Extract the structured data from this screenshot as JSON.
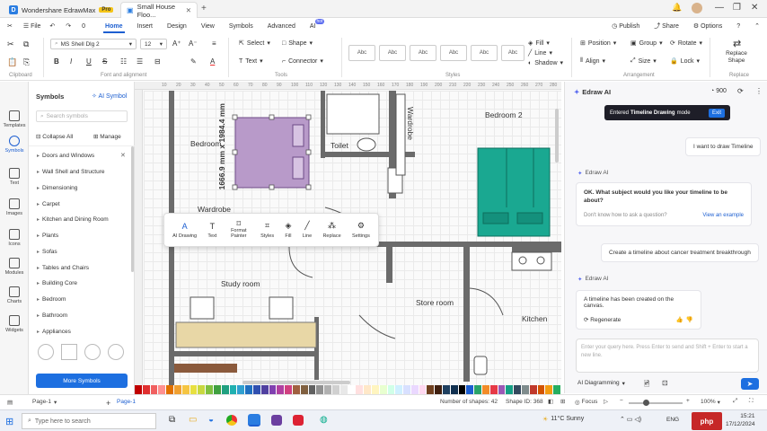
{
  "titlebar": {
    "app_name": "Wondershare EdrawMax",
    "pro": "Pro",
    "doc_tab": "Small House Floo...",
    "new_tab": "+"
  },
  "menubar": {
    "file": "File",
    "undo": "↶",
    "redo": "↷",
    "items": [
      "Home",
      "Insert",
      "Design",
      "View",
      "Symbols",
      "Advanced",
      "AI"
    ],
    "ai_badge": "hot",
    "publish": "Publish",
    "share": "Share",
    "options": "Options",
    "zero": "0"
  },
  "ribbon": {
    "font_name": "MS Shell Dlg 2",
    "font_size": "12",
    "select": "Select",
    "shape": "Shape",
    "text": "Text",
    "connector": "Connector",
    "style_swatches": [
      "Abc",
      "Abc",
      "Abc",
      "Abc",
      "Abc",
      "Abc",
      "Abc"
    ],
    "fill": "Fill",
    "line": "Line",
    "shadow": "Shadow",
    "position": "Position",
    "group": "Group",
    "rotate": "Rotate",
    "align": "Align",
    "size": "Size",
    "lock": "Lock",
    "replace_shape": "Replace Shape",
    "groups": {
      "clipboard": "Clipboard",
      "font": "Font and alignment",
      "tools": "Tools",
      "styles": "Styles",
      "arrangement": "Arrangement",
      "replace": "Replace"
    }
  },
  "rail": [
    "Templates",
    "Symbols",
    "Text",
    "Images",
    "Icons",
    "Modules",
    "Charts",
    "Widgets"
  ],
  "symbols_panel": {
    "title": "Symbols",
    "ai_symbol": "AI Symbol",
    "search_placeholder": "Search symbols",
    "collapse_all": "Collapse All",
    "manage": "Manage",
    "libraries": [
      "Doors and Windows",
      "Wall Shell and Structure",
      "Dimensioning",
      "Carpet",
      "Kitchen and Dining Room",
      "Plants",
      "Sofas",
      "Tables and Chairs",
      "Building Core",
      "Bedroom",
      "Bathroom",
      "Appliances"
    ],
    "more_symbols": "More Symbols"
  },
  "canvas": {
    "rooms": {
      "bedroom_left": "Bedroom",
      "bedroom2": "Bedroom 2",
      "toilet": "Toilet",
      "wardrobe_right": "Wardrobe",
      "wardrobe_left": "Wardrobe",
      "study": "Study room",
      "store": "Store room",
      "kitchen": "Kitchen"
    },
    "dimension": "1666.9 mm x 1984.4 mm",
    "ruler_ticks": [
      "10",
      "20",
      "30",
      "40",
      "50",
      "60",
      "70",
      "80",
      "90",
      "100",
      "110",
      "120",
      "130",
      "140",
      "150",
      "160",
      "170",
      "180",
      "190",
      "200",
      "210",
      "220",
      "230",
      "240",
      "250",
      "260",
      "270",
      "280"
    ],
    "float_toolbar": [
      "AI Drawing",
      "Text",
      "Format Painter",
      "Styles",
      "Fill",
      "Line",
      "Replace",
      "Settings"
    ]
  },
  "ai_panel": {
    "title": "Edraw AI",
    "credits": "900",
    "mode_text": "Entered",
    "mode_bold": "Timeline Drawing",
    "mode_suffix": "mode",
    "exit": "Exit",
    "user_msg_1": "I want to draw Timeline",
    "bot_name": "Edraw AI",
    "bot_msg_1": "OK. What subject would you like your timeline to be about?",
    "dont_know": "Don't know how to ask a question?",
    "view_example": "View an example",
    "user_msg_2": "Create a timeline about cancer treatment breakthrough",
    "bot_msg_2": "A timeline has been created on the canvas.",
    "regenerate": "Regenerate",
    "input_placeholder": "Enter your query here. Press Enter to send and Shift + Enter to start a new line.",
    "mode_select": "AI Diagramming"
  },
  "statusbar": {
    "page_select": "Page-1",
    "page_tab": "Page-1",
    "add_page": "+",
    "shapes": "Number of shapes: 42",
    "shape_id": "Shape ID: 368",
    "focus": "Focus",
    "zoom": "100%"
  },
  "taskbar": {
    "search_placeholder": "Type here to search",
    "weather": "11°C  Sunny",
    "lang": "ENG",
    "time": "15:21",
    "date": "17/12/2024"
  },
  "palette_colors": [
    "#c00000",
    "#e03030",
    "#f06060",
    "#ff9090",
    "#e07000",
    "#f0a030",
    "#f5c542",
    "#e8e040",
    "#c8d840",
    "#80c040",
    "#40a040",
    "#20a080",
    "#20b0b0",
    "#30a0d0",
    "#2070c0",
    "#3050b0",
    "#5040a0",
    "#8040b0",
    "#b040a0",
    "#d04080",
    "#a06040",
    "#806040",
    "#606060",
    "#909090",
    "#b0b0b0",
    "#d0d0d0",
    "#e8e8e8",
    "#ffffff",
    "#ffe0e0",
    "#ffe8c8",
    "#fff5c0",
    "#e8ffd0",
    "#d0ffe8",
    "#d0f0ff",
    "#d8e0ff",
    "#ead8ff",
    "#ffd8f0",
    "#704020",
    "#402010",
    "#204060",
    "#103050",
    "#000000",
    "#1d5fd1",
    "#29a36a",
    "#f28c28",
    "#e63946",
    "#9b59b6",
    "#16a085",
    "#34495e",
    "#7f8c8d",
    "#c0392b",
    "#d35400",
    "#f39c12",
    "#27ae60"
  ]
}
